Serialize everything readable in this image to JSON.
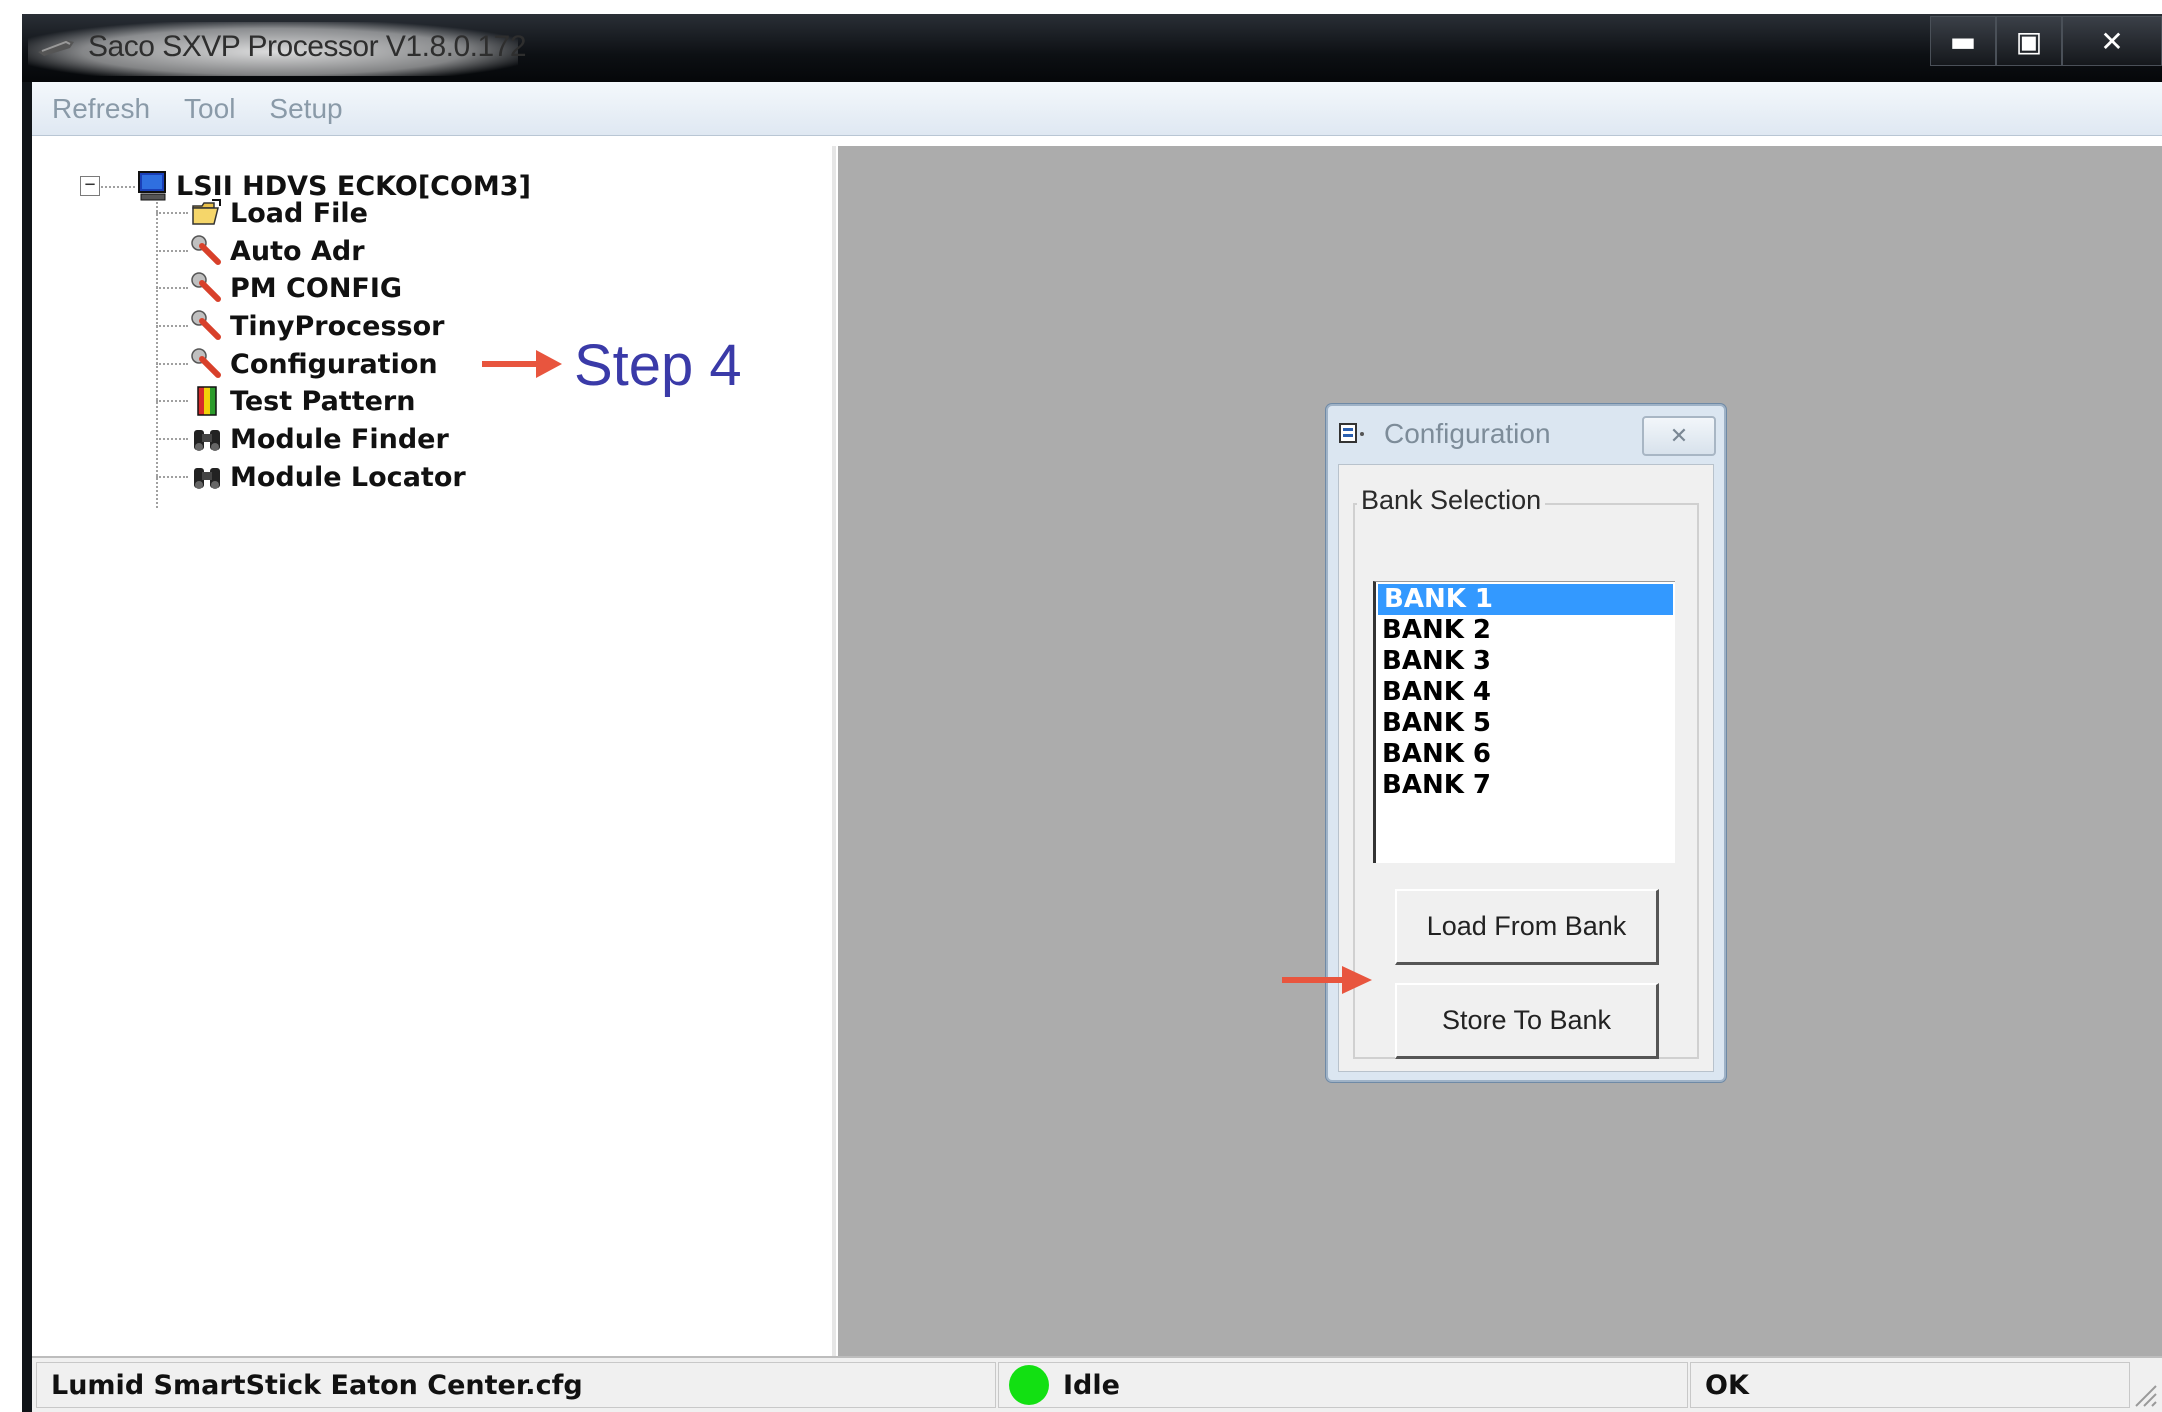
{
  "window": {
    "title": "Saco SXVP Processor  V1.8.0.172",
    "controls": {
      "minimize": "▬",
      "maximize": "▣",
      "close": "✕"
    }
  },
  "menu": [
    "Refresh",
    "Tool",
    "Setup"
  ],
  "tree": {
    "expander": "−",
    "root": {
      "label": "LSII HDVS ECKO[COM3]",
      "icon": "computer-icon"
    },
    "children": [
      {
        "label": "Load File",
        "icon": "open-folder-icon"
      },
      {
        "label": "Auto Adr",
        "icon": "wrench-icon"
      },
      {
        "label": "PM CONFIG",
        "icon": "wrench-icon"
      },
      {
        "label": "TinyProcessor",
        "icon": "wrench-icon"
      },
      {
        "label": "Configuration",
        "icon": "wrench-icon"
      },
      {
        "label": "Test Pattern",
        "icon": "color-bars-icon"
      },
      {
        "label": "Module Finder",
        "icon": "binoculars-icon"
      },
      {
        "label": "Module Locator",
        "icon": "binoculars-icon"
      }
    ]
  },
  "annotation": {
    "step_label": "Step 4",
    "arrow_color": "#e8553e"
  },
  "dialog": {
    "title": "Configuration",
    "close": "✕",
    "group_title": "Bank Selection",
    "banks": [
      "BANK 1",
      "BANK 2",
      "BANK 3",
      "BANK 4",
      "BANK 5",
      "BANK 6",
      "BANK 7"
    ],
    "selected_bank": "BANK 1",
    "load_button": "Load From Bank",
    "store_button": "Store To Bank"
  },
  "status": {
    "file": "Lumid SmartStick Eaton Center.cfg",
    "state": "Idle",
    "state_color": "#12e012",
    "result": "OK"
  },
  "colors": {
    "selection": "#3399ff",
    "mdi_background": "#acacac"
  }
}
